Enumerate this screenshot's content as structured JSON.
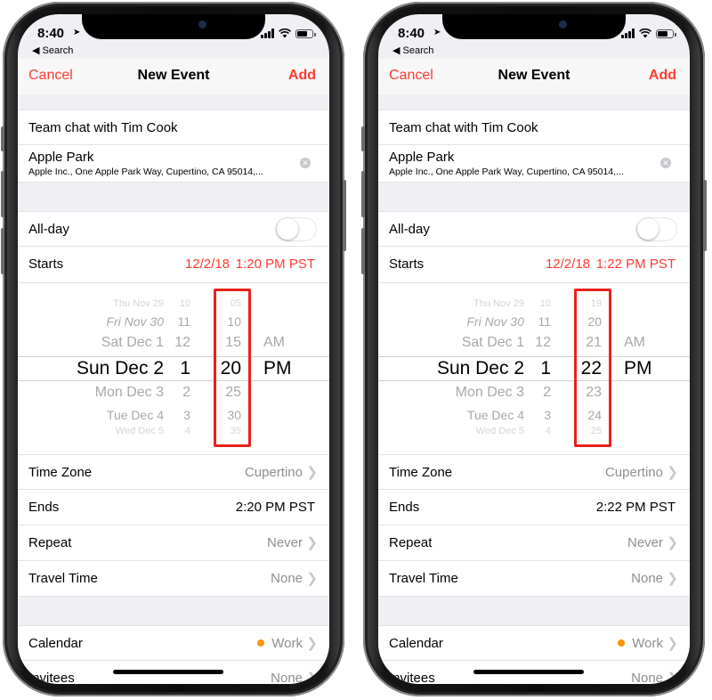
{
  "colors": {
    "accent": "#ff3b30",
    "calendar_dot": "#ff9500",
    "highlight_box": "#e8211d"
  },
  "phones": [
    {
      "status": {
        "time": "8:40",
        "back": "Search"
      },
      "nav": {
        "cancel": "Cancel",
        "title": "New Event",
        "add": "Add"
      },
      "title_field": "Team chat with Tim Cook",
      "location": {
        "name": "Apple Park",
        "address": "Apple Inc., One Apple Park Way, Cupertino, CA 95014,..."
      },
      "allday": {
        "label": "All-day",
        "on": false
      },
      "starts": {
        "label": "Starts",
        "date": "12/2/18",
        "time": "1:20 PM PST"
      },
      "picker": {
        "dates": [
          "Thu Nov 29",
          "Fri Nov 30",
          "Sat Dec 1",
          "Sun Dec 2",
          "Mon Dec 3",
          "Tue Dec 4",
          "Wed Dec 5"
        ],
        "hours": [
          "10",
          "11",
          "12",
          "1",
          "2",
          "3",
          "4"
        ],
        "minutes": [
          "05",
          "10",
          "15",
          "20",
          "25",
          "30",
          "35"
        ],
        "ampm": [
          "AM",
          "PM"
        ]
      },
      "rows": {
        "timezone": {
          "label": "Time Zone",
          "value": "Cupertino"
        },
        "ends": {
          "label": "Ends",
          "value": "2:20 PM PST"
        },
        "repeat": {
          "label": "Repeat",
          "value": "Never"
        },
        "travel": {
          "label": "Travel Time",
          "value": "None"
        },
        "calendar": {
          "label": "Calendar",
          "value": "Work"
        },
        "invitees": {
          "label": "Invitees",
          "value": "None"
        }
      }
    },
    {
      "status": {
        "time": "8:40",
        "back": "Search"
      },
      "nav": {
        "cancel": "Cancel",
        "title": "New Event",
        "add": "Add"
      },
      "title_field": "Team chat with Tim Cook",
      "location": {
        "name": "Apple Park",
        "address": "Apple Inc., One Apple Park Way, Cupertino, CA 95014,..."
      },
      "allday": {
        "label": "All-day",
        "on": false
      },
      "starts": {
        "label": "Starts",
        "date": "12/2/18",
        "time": "1:22 PM PST"
      },
      "picker": {
        "dates": [
          "Thu Nov 29",
          "Fri Nov 30",
          "Sat Dec 1",
          "Sun Dec 2",
          "Mon Dec 3",
          "Tue Dec 4",
          "Wed Dec 5"
        ],
        "hours": [
          "10",
          "11",
          "12",
          "1",
          "2",
          "3",
          "4"
        ],
        "minutes": [
          "19",
          "20",
          "21",
          "22",
          "23",
          "24",
          "25"
        ],
        "ampm": [
          "AM",
          "PM"
        ]
      },
      "rows": {
        "timezone": {
          "label": "Time Zone",
          "value": "Cupertino"
        },
        "ends": {
          "label": "Ends",
          "value": "2:22 PM PST"
        },
        "repeat": {
          "label": "Repeat",
          "value": "Never"
        },
        "travel": {
          "label": "Travel Time",
          "value": "None"
        },
        "calendar": {
          "label": "Calendar",
          "value": "Work"
        },
        "invitees": {
          "label": "Invitees",
          "value": "None"
        }
      }
    }
  ]
}
